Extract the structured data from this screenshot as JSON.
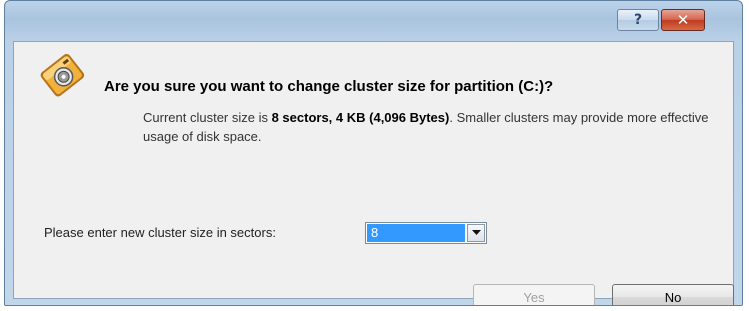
{
  "window": {
    "help_glyph": "?",
    "close_glyph": "✕",
    "help_icon": "help-icon",
    "close_icon": "close-icon",
    "app_icon": "disk-partition-icon",
    "accent_color": "#3399ff",
    "close_color": "#c03a20"
  },
  "dialog": {
    "heading": "Are you sure you want to change cluster size for partition (C:)?",
    "desc_prefix": "Current cluster size is ",
    "desc_bold": "8 sectors, 4 KB (4,096 Bytes)",
    "desc_suffix": ". Smaller clusters may provide more effective usage of disk space.",
    "size_label": "Please enter new cluster size in sectors:",
    "size_value": "8"
  },
  "buttons": {
    "yes_label": "Yes",
    "yes_enabled": false,
    "no_label": "No",
    "no_enabled": true
  }
}
